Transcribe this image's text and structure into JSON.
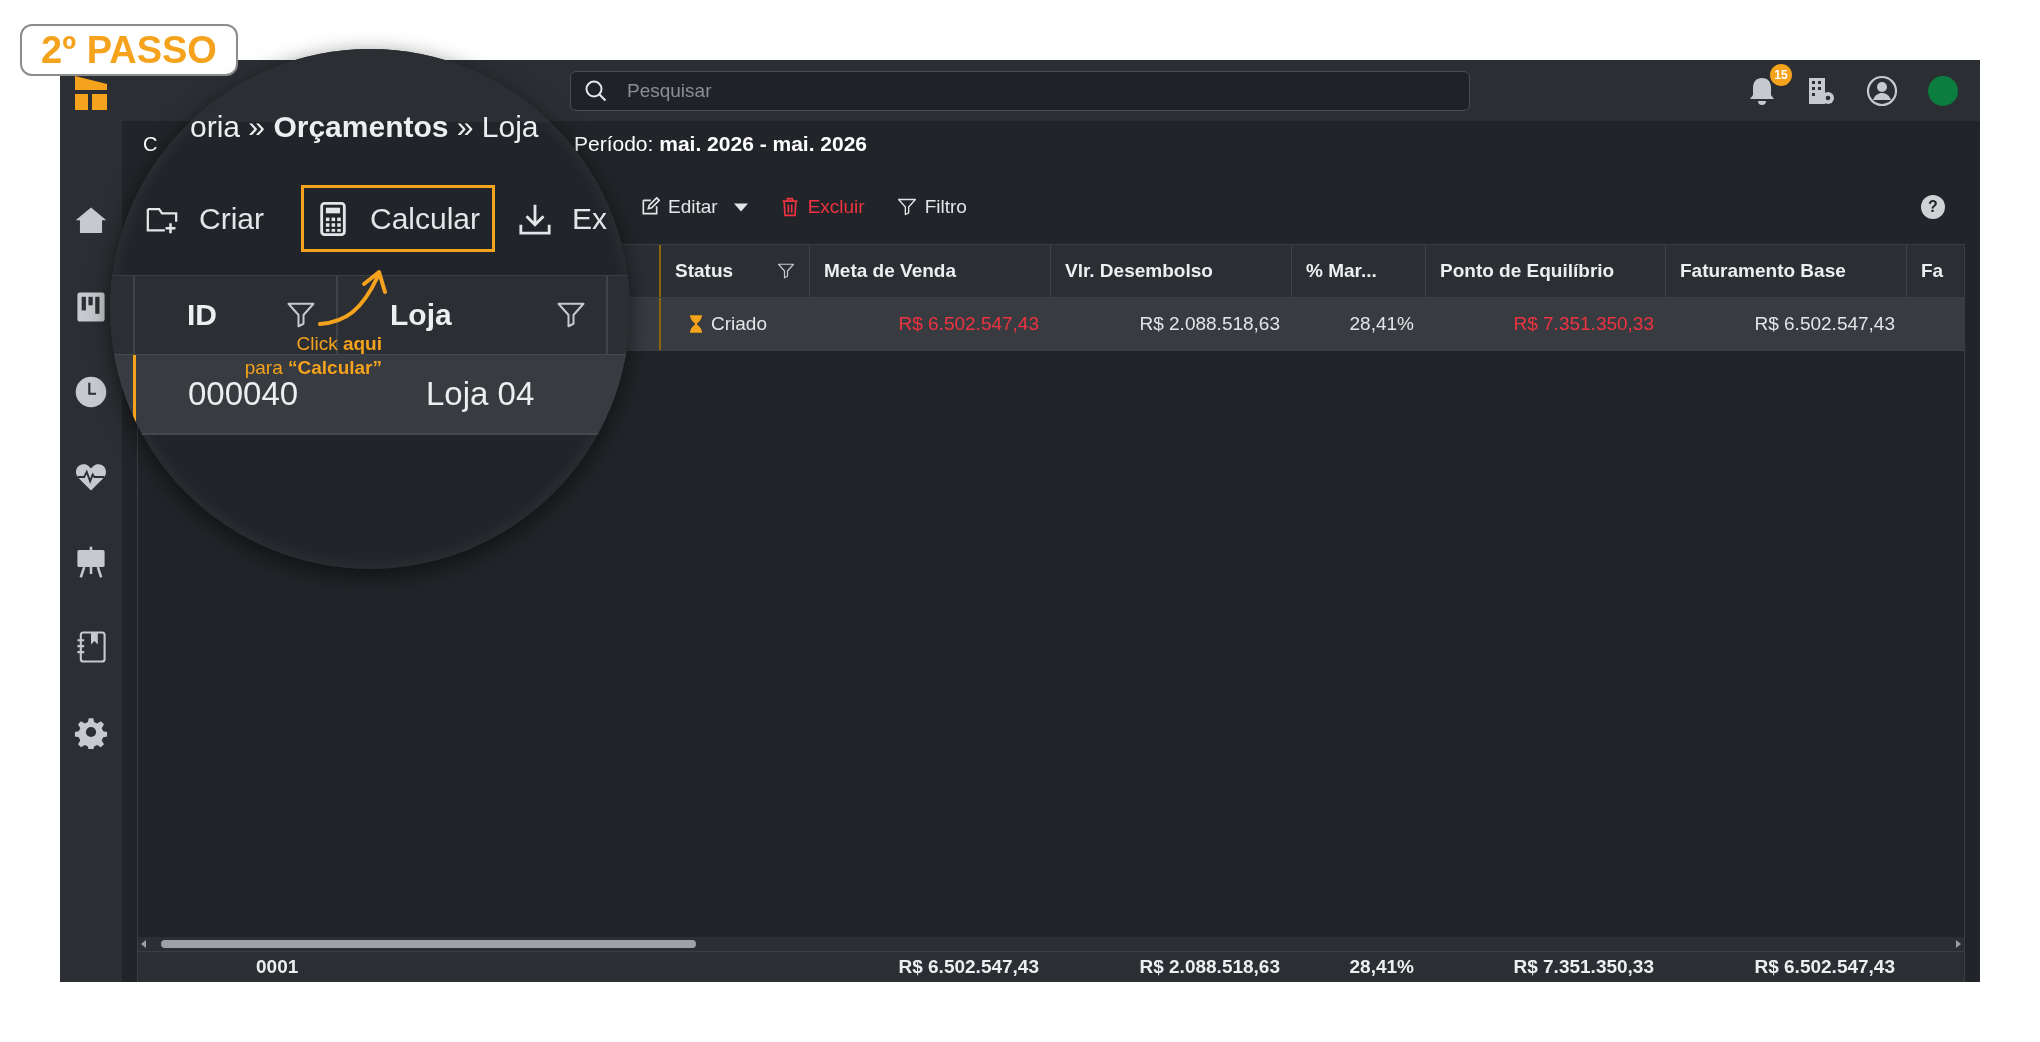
{
  "step_badge": "2º PASSO",
  "search": {
    "placeholder": "Pesquisar"
  },
  "notifications": {
    "count": "15"
  },
  "breadcrumb_fragment": "C",
  "period": "Período: **mai. 2026 - mai. 2026**",
  "help": "?",
  "toolbar": [
    {
      "label": "Editar",
      "kind": "dropdown"
    },
    {
      "label": "Excluir",
      "kind": "danger"
    },
    {
      "label": "Filtro",
      "kind": "filter"
    }
  ],
  "table": {
    "columns": [
      {
        "label": "Status",
        "filter": true
      },
      {
        "label": "Meta de Venda",
        "filter": false
      },
      {
        "label": "Vlr. Desembolso",
        "filter": false
      },
      {
        "label": "% Mar...",
        "filter": false
      },
      {
        "label": "Ponto de Equilíbrio",
        "filter": false
      },
      {
        "label": "Faturamento Base",
        "filter": false
      },
      {
        "label": "Fa"
      }
    ],
    "rows": [
      {
        "selected": true,
        "cells": [
          {
            "kind": "status",
            "text": "Criado"
          },
          {
            "kind": "amount",
            "text": "R$ 6.502.547,43",
            "alert": true
          },
          {
            "kind": "amount",
            "text": "R$ 2.088.518,63",
            "alert": false
          },
          {
            "kind": "amount",
            "text": "28,41%",
            "alert": false
          },
          {
            "kind": "amount",
            "text": "R$ 7.351.350,33",
            "alert": true
          },
          {
            "kind": "amount",
            "text": "R$ 6.502.547,43",
            "alert": false
          }
        ]
      }
    ]
  },
  "footer": {
    "count": "0001",
    "totals": [
      "R$ 6.502.547,43",
      "R$ 2.088.518,63",
      "28,41%",
      "R$ 7.351.350,33",
      "R$ 6.502.547,43"
    ]
  },
  "lens": {
    "breadcrumb": "oria » **Orçamentos** » Loja",
    "toolbar": [
      {
        "label": "Criar",
        "kind": "create",
        "highlighted": false
      },
      {
        "label": "Calcular",
        "kind": "calculate",
        "highlighted": true
      },
      {
        "label": "Ex",
        "kind": "export",
        "highlighted": false
      }
    ],
    "columns": [
      {
        "label": "ID",
        "filter": true
      },
      {
        "label": "Loja",
        "filter": true
      }
    ],
    "row": {
      "selected": true,
      "cells": [
        "000040",
        "Loja 04"
      ]
    }
  },
  "callout": [
    "Click **aqui**",
    "para **“Calcular”**"
  ]
}
